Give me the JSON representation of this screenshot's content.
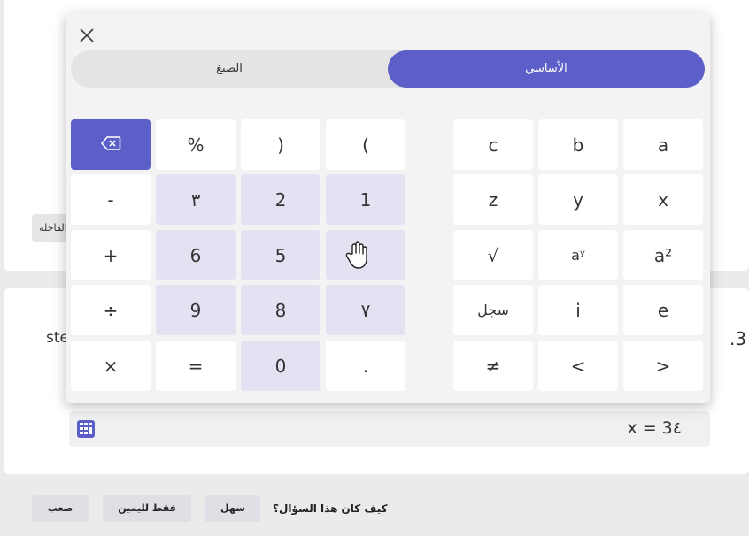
{
  "background": {
    "question_label": "القاحله",
    "question_number": ".3",
    "side_text": "stets",
    "answer_value": "x = 3٤"
  },
  "feedback": {
    "question": "كيف كان هذا السؤال؟",
    "easy": "سهل",
    "medium": "فقط لليمين",
    "hard": "صعب"
  },
  "calculator": {
    "tabs": {
      "basic": "الأساسي",
      "formulas": "الصيغ"
    },
    "keys": {
      "percent": "%",
      "paren_close": ")",
      "paren_open": "(",
      "minus": "-",
      "three": "٣",
      "two": "2",
      "one": "1",
      "plus": "+",
      "six": "6",
      "five": "5",
      "divide": "÷",
      "nine": "9",
      "eight": "8",
      "seven": "٧",
      "multiply": "×",
      "equals": "=",
      "zero": "0",
      "decimal": ".",
      "c": "c",
      "b": "b",
      "a": "a",
      "z": "z",
      "y": "y",
      "x": "x",
      "sqrt": "√",
      "a_pow_y": "aʸ",
      "a_squared": "a²",
      "log": "سجل",
      "i": "i",
      "e": "e",
      "not_equal": "≠",
      "less_than": "<",
      "greater_than": ">"
    }
  },
  "colors": {
    "accent": "#5b5fc7",
    "number_key": "#e2e2f2",
    "panel": "#f3f3f3"
  }
}
